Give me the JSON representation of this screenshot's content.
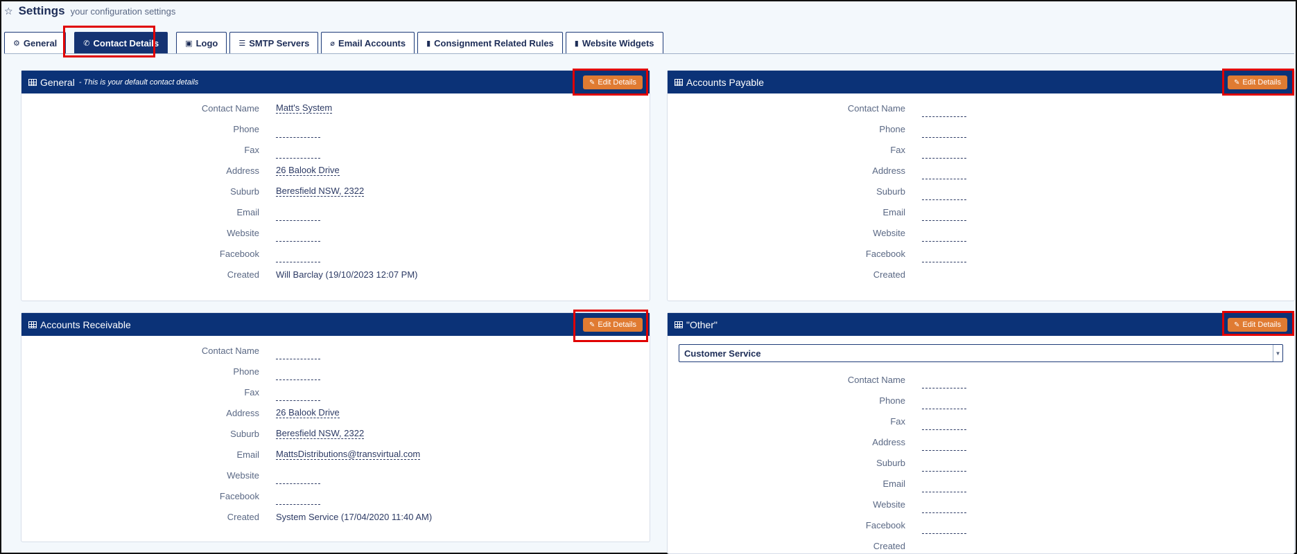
{
  "header": {
    "title": "Settings",
    "subtitle": "your configuration settings",
    "star_icon": "star-icon"
  },
  "tabs": [
    {
      "label": "General",
      "icon": "gear-icon",
      "glyph": "⚙",
      "active": false
    },
    {
      "label": "Contact Details",
      "icon": "phone-icon",
      "glyph": "📞",
      "active": true
    },
    {
      "label": "Logo",
      "icon": "image-icon",
      "glyph": "🖼",
      "active": false
    },
    {
      "label": "SMTP Servers",
      "icon": "server-icon",
      "glyph": "☰",
      "active": false
    },
    {
      "label": "Email Accounts",
      "icon": "paperclip-icon",
      "glyph": "📎",
      "active": false
    },
    {
      "label": "Consignment Related Rules",
      "icon": "document-icon",
      "glyph": "▮",
      "active": false
    },
    {
      "label": "Website Widgets",
      "icon": "document-icon",
      "glyph": "▮",
      "active": false
    }
  ],
  "edit_label": "Edit Details",
  "panels": {
    "general": {
      "title": "General",
      "subtitle": "- This is your default contact details",
      "fields": [
        {
          "label": "Contact Name",
          "value": "Matt's System",
          "link": true
        },
        {
          "label": "Phone",
          "value": ""
        },
        {
          "label": "Fax",
          "value": ""
        },
        {
          "label": "Address",
          "value": "26 Balook Drive",
          "link": true
        },
        {
          "label": "Suburb",
          "value": "Beresfield NSW, 2322",
          "link": true
        },
        {
          "label": "Email",
          "value": ""
        },
        {
          "label": "Website",
          "value": ""
        },
        {
          "label": "Facebook",
          "value": ""
        },
        {
          "label": "Created",
          "value": "Will Barclay (19/10/2023 12:07 PM)",
          "link": false
        }
      ]
    },
    "accounts_payable": {
      "title": "Accounts Payable",
      "fields": [
        {
          "label": "Contact Name",
          "value": ""
        },
        {
          "label": "Phone",
          "value": ""
        },
        {
          "label": "Fax",
          "value": ""
        },
        {
          "label": "Address",
          "value": ""
        },
        {
          "label": "Suburb",
          "value": ""
        },
        {
          "label": "Email",
          "value": ""
        },
        {
          "label": "Website",
          "value": ""
        },
        {
          "label": "Facebook",
          "value": ""
        },
        {
          "label": "Created",
          "value": "",
          "plain": true
        }
      ]
    },
    "accounts_receivable": {
      "title": "Accounts Receivable",
      "fields": [
        {
          "label": "Contact Name",
          "value": ""
        },
        {
          "label": "Phone",
          "value": ""
        },
        {
          "label": "Fax",
          "value": ""
        },
        {
          "label": "Address",
          "value": "26 Balook Drive",
          "link": true
        },
        {
          "label": "Suburb",
          "value": "Beresfield NSW, 2322",
          "link": true
        },
        {
          "label": "Email",
          "value": "MattsDistributions@transvirtual.com",
          "link": true
        },
        {
          "label": "Website",
          "value": ""
        },
        {
          "label": "Facebook",
          "value": ""
        },
        {
          "label": "Created",
          "value": "System Service (17/04/2020 11:40 AM)",
          "link": false
        }
      ]
    },
    "other": {
      "title": "\"Other\"",
      "select_value": "Customer Service",
      "fields": [
        {
          "label": "Contact Name",
          "value": ""
        },
        {
          "label": "Phone",
          "value": ""
        },
        {
          "label": "Fax",
          "value": ""
        },
        {
          "label": "Address",
          "value": ""
        },
        {
          "label": "Suburb",
          "value": ""
        },
        {
          "label": "Email",
          "value": ""
        },
        {
          "label": "Website",
          "value": ""
        },
        {
          "label": "Facebook",
          "value": ""
        },
        {
          "label": "Created",
          "value": "",
          "plain": true
        }
      ]
    }
  },
  "colors": {
    "header_bar": "#0b3277",
    "edit_button": "#e07b32",
    "highlight": "#e00000",
    "active_tab": "#153372"
  }
}
